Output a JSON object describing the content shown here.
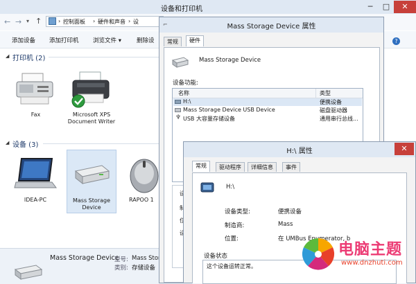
{
  "explorer": {
    "title": "设备和打印机",
    "breadcrumb": [
      "控制面板",
      "硬件和声音",
      "设"
    ],
    "toolbar": [
      "添加设备",
      "添加打印机",
      "浏览文件 ▾",
      "删除设"
    ],
    "printers_header": "打印机 (2)",
    "devices_header": "设备 (3)",
    "printers": [
      {
        "name": "Fax"
      },
      {
        "name": "Microsoft XPS Document Writer"
      }
    ],
    "devices": [
      {
        "name": "IDEA-PC"
      },
      {
        "name": "Mass Storage Device"
      },
      {
        "name": "RAPOO 1"
      }
    ],
    "details": {
      "name": "Mass Storage Device",
      "model_label": "型号:",
      "model_value": "Mass Stor",
      "category_label": "类别:",
      "category_value": "存储设备"
    }
  },
  "props": {
    "title": "Mass Storage Device 属性",
    "tabs": [
      "常规",
      "硬件"
    ],
    "device_name": "Mass Storage Device",
    "functions_label": "设备功能:",
    "col_name": "名称",
    "col_type": "类型",
    "rows": [
      {
        "name": "H:\\",
        "type": "便携设备"
      },
      {
        "name": "Mass Storage Device USB Device",
        "type": "磁盘驱动器"
      },
      {
        "name": "USB 大容量存储设备",
        "type": "通用串行总线..."
      }
    ],
    "side_labels": [
      "设",
      "制",
      "位置",
      "设"
    ]
  },
  "hprops": {
    "title": "H:\\ 属性",
    "tabs": [
      "常规",
      "驱动程序",
      "详细信息",
      "事件"
    ],
    "name": "H:\\",
    "type_label": "设备类型:",
    "type_value": "便携设备",
    "mfr_label": "制造商:",
    "mfr_value": "Mass",
    "loc_label": "位置:",
    "loc_value": "在 UMBus Enumerator, b",
    "status_label": "设备状态",
    "status_text": "这个设备运转正常。"
  },
  "watermark": {
    "brand": "电脑主题",
    "url": "www.dnzhuti.com"
  }
}
